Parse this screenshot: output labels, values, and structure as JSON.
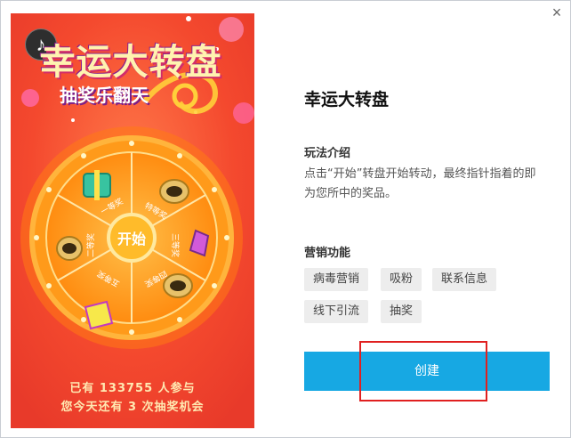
{
  "dialog": {
    "close_glyph": "×",
    "preview": {
      "banner_title": "幸运大转盘",
      "banner_subtitle": "抽奖乐翻天",
      "wheel_center_label": "开始",
      "wheel_prizes": [
        "一等奖",
        "特等奖",
        "三等奖",
        "四等奖",
        "五等奖",
        "二等奖"
      ],
      "footer_line1": "已有 133755 人参与",
      "footer_line2": "您今天还有 3 次抽奖机会",
      "music_icon": "music-note-icon"
    },
    "title": "幸运大转盘",
    "rules_heading": "玩法介绍",
    "rules_text": "点击“开始”转盘开始转动，最终指针指着的即为您所中的奖品。",
    "marketing_heading": "营销功能",
    "tags": [
      "病毒营销",
      "吸粉",
      "联系信息",
      "线下引流",
      "抽奖"
    ],
    "create_button": "创建",
    "colors": {
      "accent": "#17a8e3",
      "highlight": "#e02020",
      "preview_bg": "#f4492e",
      "wheel_orange": "#ff9b1a"
    }
  }
}
